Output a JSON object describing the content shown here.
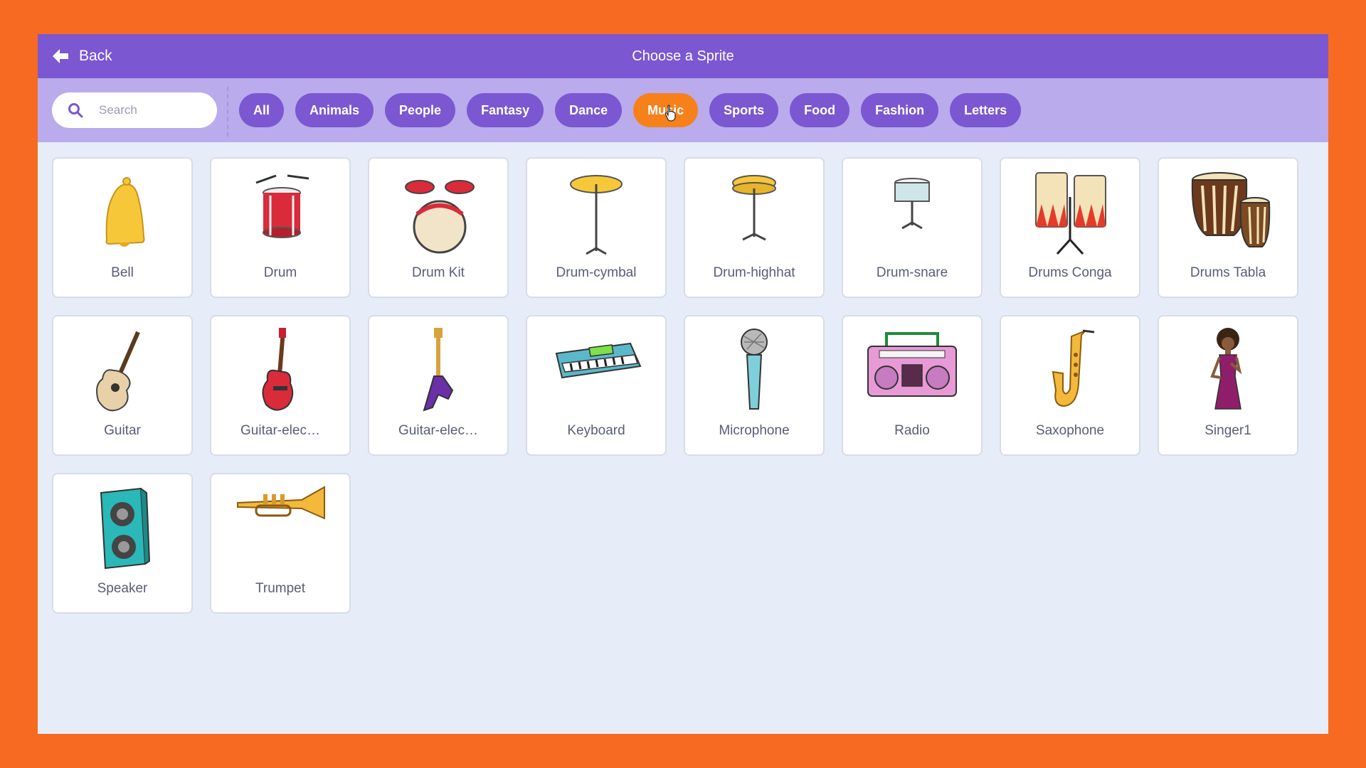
{
  "header": {
    "back_label": "Back",
    "title": "Choose a Sprite"
  },
  "search": {
    "placeholder": "Search"
  },
  "tags": [
    "All",
    "Animals",
    "People",
    "Fantasy",
    "Dance",
    "Music",
    "Sports",
    "Food",
    "Fashion",
    "Letters"
  ],
  "active_tag": "Music",
  "sprites": [
    {
      "name": "Bell",
      "icon": "bell-icon"
    },
    {
      "name": "Drum",
      "icon": "drum-icon"
    },
    {
      "name": "Drum Kit",
      "icon": "drum-kit-icon"
    },
    {
      "name": "Drum-cymbal",
      "icon": "cymbal-icon"
    },
    {
      "name": "Drum-highhat",
      "icon": "highhat-icon"
    },
    {
      "name": "Drum-snare",
      "icon": "snare-icon"
    },
    {
      "name": "Drums Conga",
      "icon": "conga-icon"
    },
    {
      "name": "Drums Tabla",
      "icon": "tabla-icon"
    },
    {
      "name": "Guitar",
      "icon": "guitar-icon"
    },
    {
      "name": "Guitar-elec…",
      "icon": "electric-guitar-red-icon"
    },
    {
      "name": "Guitar-elec…",
      "icon": "electric-guitar-purple-icon"
    },
    {
      "name": "Keyboard",
      "icon": "keyboard-icon"
    },
    {
      "name": "Microphone",
      "icon": "microphone-icon"
    },
    {
      "name": "Radio",
      "icon": "radio-icon"
    },
    {
      "name": "Saxophone",
      "icon": "saxophone-icon"
    },
    {
      "name": "Singer1",
      "icon": "singer-icon"
    },
    {
      "name": "Speaker",
      "icon": "speaker-icon"
    },
    {
      "name": "Trumpet",
      "icon": "trumpet-icon"
    }
  ],
  "colors": {
    "frame": "#f76a22",
    "header": "#7b57d2",
    "filterbar": "#b9abec",
    "tag": "#7b57d2",
    "tag_active": "#f6811a",
    "content_bg": "#e6ecf8"
  }
}
